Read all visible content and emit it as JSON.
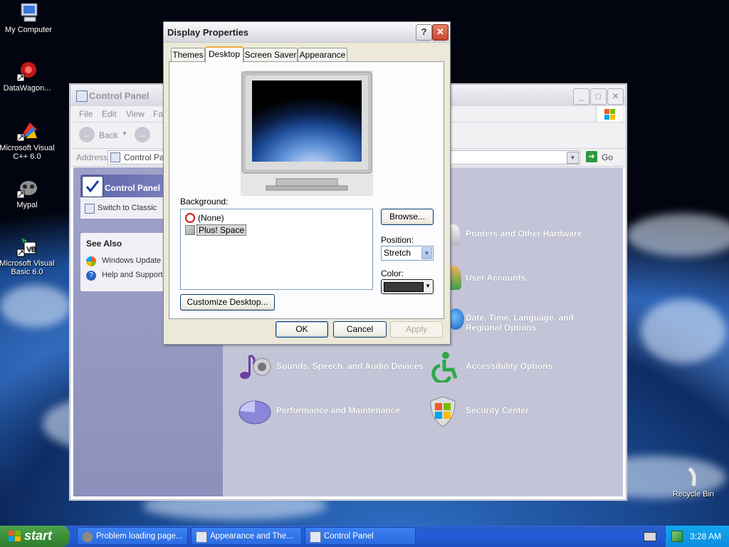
{
  "desktop": {
    "icons": [
      {
        "label": "My Computer",
        "icon": "my-computer-icon"
      },
      {
        "label": "DataWagon...",
        "icon": "datawagon-shortcut-icon"
      },
      {
        "label": "Microsoft Visual C++ 6.0",
        "icon": "visual-cpp-shortcut-icon"
      },
      {
        "label": "Mypal",
        "icon": "mypal-shortcut-icon"
      },
      {
        "label": "Microsoft Visual Basic 6.0",
        "icon": "visual-basic-shortcut-icon"
      }
    ],
    "recycle_bin": "Recycle Bin"
  },
  "control_panel": {
    "title": "Control Panel",
    "menu": [
      "File",
      "Edit",
      "View",
      "Fa"
    ],
    "back_label": "Back",
    "address_label": "Address",
    "address_value": "Control Pan",
    "go_label": "Go",
    "left_panel_title": "Control Panel",
    "switch_label": "Switch to Classic",
    "see_also_title": "See Also",
    "see_also_items": [
      "Windows Update",
      "Help and Support"
    ],
    "categories": [
      {
        "label": "Printers and Other Hardware",
        "icon": "printer-icon"
      },
      {
        "label": "User Accounts",
        "icon": "user-accounts-icon"
      },
      {
        "label": "Date, Time, Language, and",
        "label2": "Regional Options",
        "icon": "globe-clock-icon"
      },
      {
        "label": "Sounds, Speech, and Audio Devices",
        "icon": "speaker-note-icon"
      },
      {
        "label": "Accessibility Options",
        "icon": "accessibility-icon"
      },
      {
        "label": "Performance and Maintenance",
        "icon": "pie-chart-icon"
      },
      {
        "label": "Security Center",
        "icon": "shield-icon"
      }
    ]
  },
  "dialog": {
    "title": "Display Properties",
    "tabs": [
      "Themes",
      "Desktop",
      "Screen Saver",
      "Appearance"
    ],
    "active_tab": "Desktop",
    "background_label": "Background:",
    "background_items": [
      "(None)",
      "Plus! Space"
    ],
    "selected_background": "Plus! Space",
    "browse_label": "Browse...",
    "position_label": "Position:",
    "position_value": "Stretch",
    "color_label": "Color:",
    "color_value": "#3a3a3a",
    "customize_label": "Customize Desktop...",
    "ok_label": "OK",
    "cancel_label": "Cancel",
    "apply_label": "Apply"
  },
  "taskbar": {
    "start_label": "start",
    "buttons": [
      "Problem loading page...",
      "Appearance and The...",
      "Control Panel"
    ],
    "clock": "3:28 AM"
  }
}
